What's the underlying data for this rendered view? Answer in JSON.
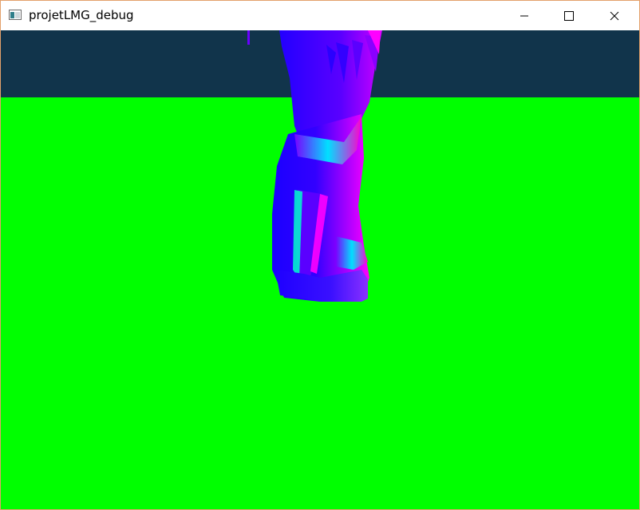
{
  "window": {
    "title": "projetLMG_debug",
    "controls": [
      "minimize-icon",
      "maximize-icon",
      "close-icon"
    ]
  },
  "scene": {
    "sky_color": "#11344b",
    "ground_color": "#00ff00",
    "model_colors": [
      "#0000ff",
      "#4d00ff",
      "#ff00ff",
      "#00ffcc"
    ]
  }
}
